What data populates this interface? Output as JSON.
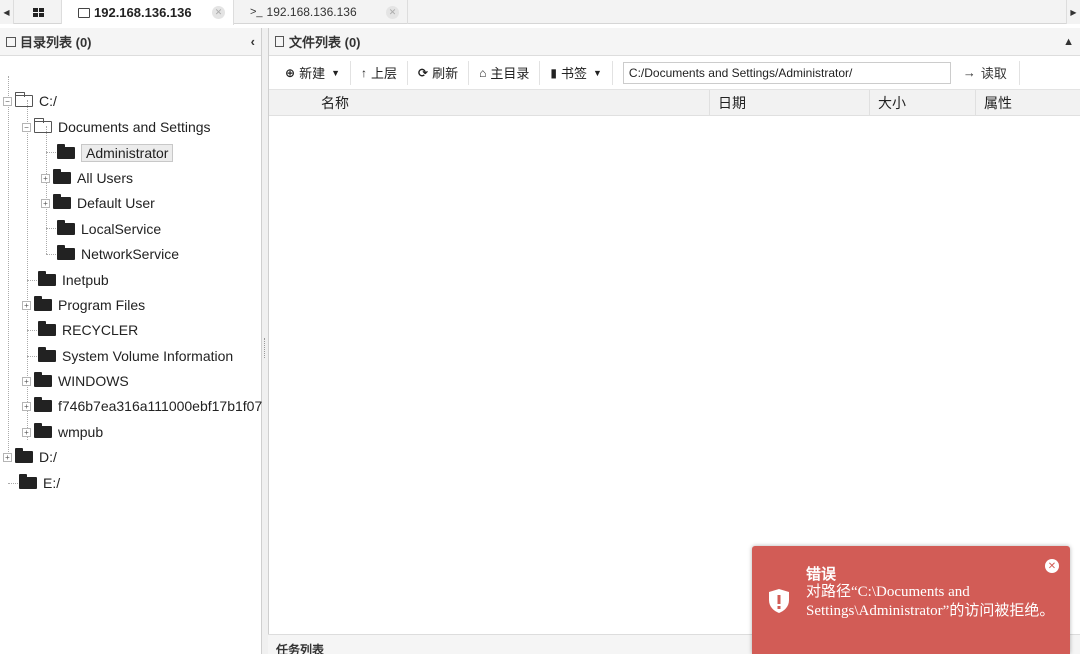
{
  "tabs": {
    "active": {
      "title": "192.168.136.136"
    },
    "terminal": {
      "prefix": ">_",
      "title": "192.168.136.136"
    }
  },
  "left_panel": {
    "title": "目录列表 (0)",
    "tree": [
      {
        "label": "C:/"
      },
      {
        "label": "Documents and Settings"
      },
      {
        "label": "Administrator"
      },
      {
        "label": "All Users"
      },
      {
        "label": "Default User"
      },
      {
        "label": "LocalService"
      },
      {
        "label": "NetworkService"
      },
      {
        "label": "Inetpub"
      },
      {
        "label": "Program Files"
      },
      {
        "label": "RECYCLER"
      },
      {
        "label": "System Volume Information"
      },
      {
        "label": "WINDOWS"
      },
      {
        "label": "f746b7ea316a111000ebf17b1f07"
      },
      {
        "label": "wmpub"
      },
      {
        "label": "D:/"
      },
      {
        "label": "E:/"
      }
    ]
  },
  "right_panel": {
    "title": "文件列表 (0)",
    "toolbar": {
      "new": "新建",
      "up": "上层",
      "refresh": "刷新",
      "home": "主目录",
      "bookmark": "书签",
      "path": "C:/Documents and Settings/Administrator/",
      "read": "读取"
    },
    "columns": [
      "名称",
      "日期",
      "大小",
      "属性"
    ]
  },
  "bottom_bar": {
    "title": "任务列表"
  },
  "toast": {
    "title": "错误",
    "message": "对路径“C:\\Documents and Settings\\Administrator”的访问被拒绝。"
  },
  "colors": {
    "toast_bg": "#d25c56"
  }
}
